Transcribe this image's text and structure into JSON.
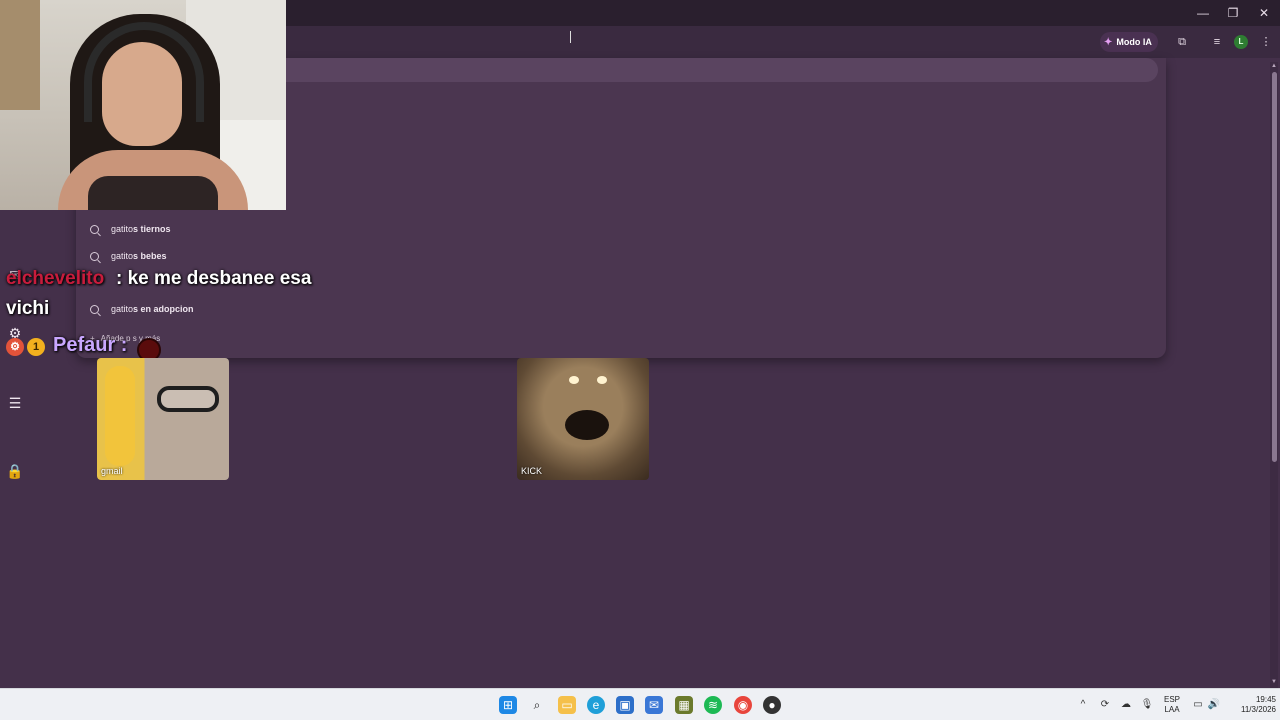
{
  "window": {
    "minimize": "—",
    "restore": "❐",
    "close": "✕"
  },
  "toolbar": {
    "modo_ia_label": "Modo IA",
    "profile_initial": "L"
  },
  "omnibox": {
    "suggestions": [
      {
        "prefix": "gatito",
        "rest": "s tiernos"
      },
      {
        "prefix": "gatito",
        "rest": "s bebes"
      },
      {
        "prefix": "gatito",
        "rest": "s en adopcion"
      }
    ],
    "add_label": "Añade p     s y más"
  },
  "stream_chat": {
    "user1": "elchevelito",
    "message1": ": ke me desbanee esa",
    "message1_cont": "vichi",
    "badge_count": "1",
    "user2": "Pefaur :"
  },
  "shortcuts": [
    {
      "label": "gmail"
    },
    {
      "label": "KICK"
    }
  ],
  "taskbar": {
    "language": "ESP",
    "keyboard": "LAA",
    "time": "19:45",
    "date": "11/3/2026"
  },
  "colors": {
    "page_bg": "#44304a",
    "dropdown_bg": "#4b3650",
    "accent_user_red": "#c81c3c",
    "accent_user_purple": "#c9a7ff"
  }
}
